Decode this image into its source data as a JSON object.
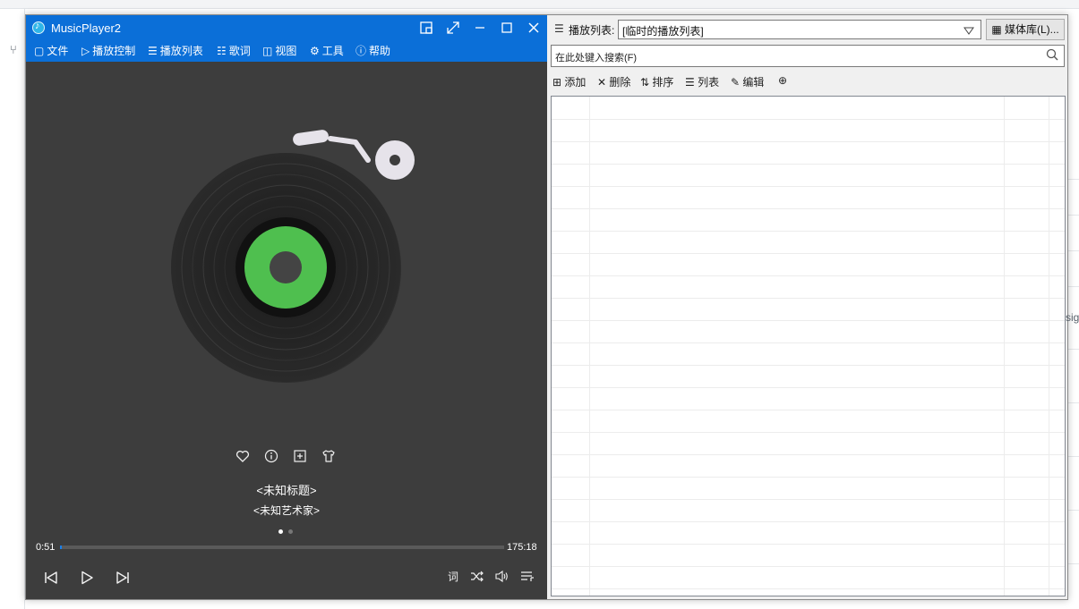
{
  "app": {
    "title": "MusicPlayer2"
  },
  "menu": [
    {
      "icon": "folder-icon",
      "glyph": "▢",
      "label": "文件"
    },
    {
      "icon": "play-outline-icon",
      "glyph": "▷",
      "label": "播放控制"
    },
    {
      "icon": "playlist-icon",
      "glyph": "☰",
      "label": "播放列表"
    },
    {
      "icon": "lyrics-icon",
      "glyph": "☷",
      "label": "歌词"
    },
    {
      "icon": "view-icon",
      "glyph": "◫",
      "label": "视图"
    },
    {
      "icon": "gear-icon",
      "glyph": "⚙",
      "label": "工具"
    },
    {
      "icon": "help-icon",
      "glyph": "?",
      "label": "帮助"
    }
  ],
  "player": {
    "title": "<未知标题>",
    "artist": "<未知艺术家>",
    "current_time": "0:51",
    "total_time": "175:18",
    "progress": 0.005,
    "page_indicator": {
      "active": 1,
      "total": 2
    }
  },
  "playlist_panel": {
    "label": "播放列表:",
    "selected": "[临时的播放列表]",
    "library_button": "媒体库(L)...",
    "search_placeholder": "在此处键入搜索(F)",
    "toolbar": {
      "add": "添加",
      "delete": "删除",
      "sort": "排序",
      "list": "列表",
      "edit": "编辑"
    }
  },
  "colors": {
    "accent": "#0b6fd8",
    "player_bg": "#3d3d3d",
    "disc_label": "#4fbf4f",
    "progress": "#1a7fe8"
  }
}
